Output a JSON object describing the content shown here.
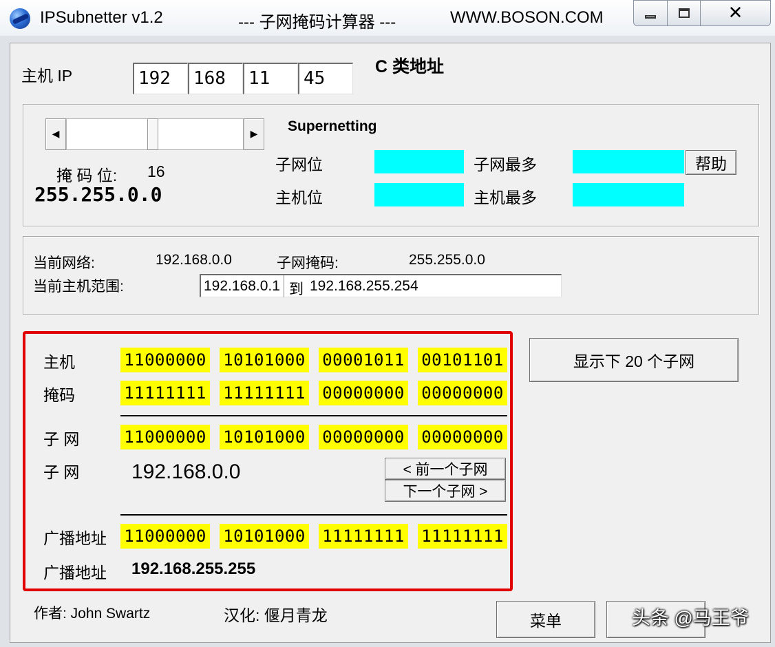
{
  "titlebar": {
    "app_name": "IPSubnetter v1.2",
    "subtitle": "--- 子网掩码计算器 ---",
    "website": "WWW.BOSON.COM",
    "minimize_glyph": "",
    "maximize_glyph": "",
    "close_glyph": "✕"
  },
  "host_ip": {
    "label": "主机 IP",
    "octets": [
      "192",
      "168",
      "11",
      "45"
    ],
    "class_label": "C 类地址"
  },
  "mask_panel": {
    "scroll_left_glyph": "◀",
    "scroll_right_glyph": "▶",
    "supernetting_label": "Supernetting",
    "mask_bits_label": "掩 码 位:",
    "mask_bits_value": "16",
    "mask_value": "255.255.0.0",
    "subnet_bits_label": "子网位",
    "host_bits_label": "主机位",
    "max_subnets_label": "子网最多",
    "max_hosts_label": "主机最多",
    "help_button": "帮助",
    "cyan_color": "#00ffff"
  },
  "network_info": {
    "current_network_label": "当前网络:",
    "current_network_value": "192.168.0.0",
    "subnet_mask_label": "子网掩码:",
    "subnet_mask_value": "255.255.0.0",
    "host_range_label": "当前主机范围:",
    "host_range_start": "192.168.0.1",
    "host_range_to": "到",
    "host_range_end": "192.168.255.254"
  },
  "binary": {
    "highlight_color": "#ffff00",
    "frame_color": "#e10000",
    "host_label": "主机",
    "host_bits": [
      "11000000",
      "10101000",
      "00001011",
      "00101101"
    ],
    "mask_label": "掩码",
    "mask_bits": [
      "11111111",
      "11111111",
      "00000000",
      "00000000"
    ],
    "subnet_label": "子 网",
    "subnet_bits": [
      "11000000",
      "10101000",
      "00000000",
      "00000000"
    ],
    "subnet_ip_label": "子 网",
    "subnet_ip": "192.168.0.0",
    "prev_subnet_button": "< 前一个子网",
    "next_subnet_button": "下一个子网 >",
    "broadcast_label": "广播地址",
    "broadcast_bits": [
      "11000000",
      "10101000",
      "11111111",
      "11111111"
    ],
    "broadcast_ip_label": "广播地址",
    "broadcast_ip": "192.168.255.255"
  },
  "show_next_button": "显示下 20 个子网",
  "footer": {
    "author": "作者: John Swartz",
    "translator": "汉化: 偃月青龙",
    "menu_button": "菜单",
    "watermark": "头条 @马王爷"
  }
}
